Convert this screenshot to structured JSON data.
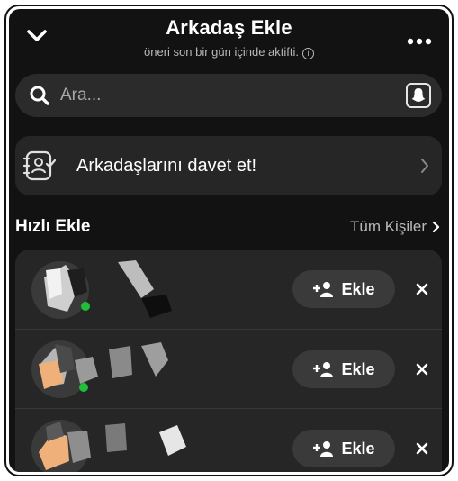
{
  "header": {
    "title": "Arkadaş Ekle",
    "subtitle": "öneri son bir gün içinde aktifti.",
    "info_icon": "i"
  },
  "search": {
    "placeholder": "Ara..."
  },
  "invite": {
    "label": "Arkadaşlarını davet et!"
  },
  "quick_add": {
    "title": "Hızlı Ekle",
    "all_contacts_label": "Tüm Kişiler",
    "add_label": "Ekle",
    "items": [
      {
        "name": ""
      },
      {
        "name": ""
      },
      {
        "name": ""
      }
    ]
  },
  "colors": {
    "background": "#121212",
    "card": "#262626",
    "button": "#3a3a3a",
    "online_dot": "#1fbf3a"
  },
  "icons": [
    "chevron-down-icon",
    "more-icon",
    "info-icon",
    "search-icon",
    "snapchat-ghost-icon",
    "contacts-book-icon",
    "chevron-right-icon",
    "add-friend-icon",
    "close-icon"
  ]
}
